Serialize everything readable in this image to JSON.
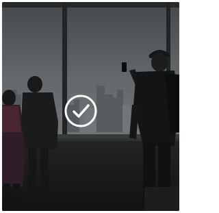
{
  "media_card": {
    "image_description_icon": "photo-thumbnail",
    "badge_icon": "check-circle-icon",
    "colors": {
      "badge_stroke": "#ffffff",
      "overlay": "#000000",
      "sky": "#5f6468",
      "floor": "#1b1c1d"
    }
  }
}
